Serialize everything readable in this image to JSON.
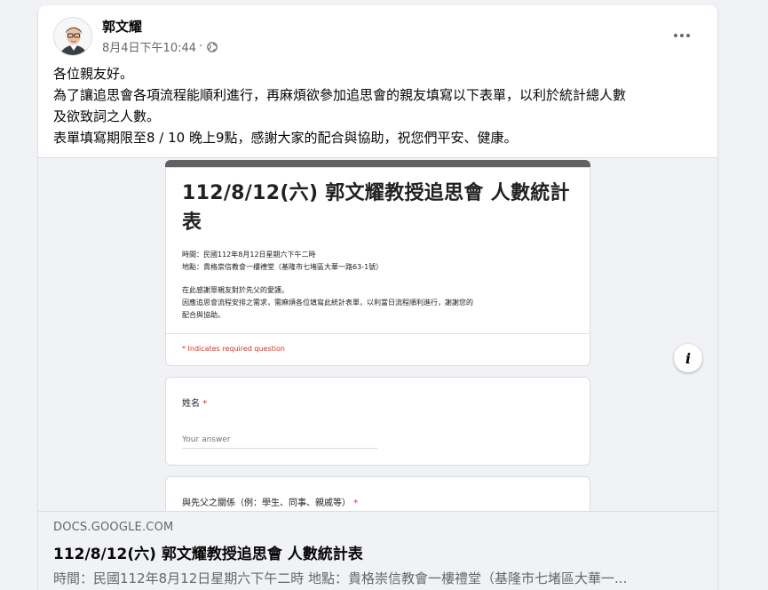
{
  "post": {
    "author": "郭文耀",
    "date": "8月4日下午10:44",
    "privacy_icon": "globe-icon",
    "more_icon": "more-dots-icon",
    "text_lines": [
      "各位親友好。",
      "為了讓追思會各項流程能順利進行，再麻煩欲參加追思會的親友填寫以下表單，以利於統計總人數",
      "及欲致詞之人數。",
      "表單填寫期限至8 / 10 晚上9點，感謝大家的配合與協助，祝您們平安、健康。"
    ]
  },
  "preview": {
    "form_title": "112/8/12(六) 郭文耀教授追思會 人數統計表",
    "time_line": "時間：民國112年8月12日星期六下午二時",
    "place_line": "地點：貴格崇信教會一樓禮堂（基隆市七堵區大華一路63-1號）",
    "thanks_line": "在此感謝眾親友對於先父的愛護。",
    "request_line_1": "因應追思會流程安排之需求，需麻煩各位填寫此統計表單，以利當日流程順利進行，謝謝您的",
    "request_line_2": "配合與協助。",
    "required_note": "* Indicates required question",
    "q1_label": "姓名",
    "q1_placeholder": "Your answer",
    "q2_label": "與先父之關係（例：學生、同事、親戚等）",
    "required_star": "*",
    "info_icon": "info-icon"
  },
  "link": {
    "domain": "DOCS.GOOGLE.COM",
    "title": "112/8/12(六) 郭文耀教授追思會 人數統計表",
    "description": "時間：民國112年8月12日星期六下午二時 地點：貴格崇信教會一樓禮堂（基隆市七堵區大華一..."
  }
}
